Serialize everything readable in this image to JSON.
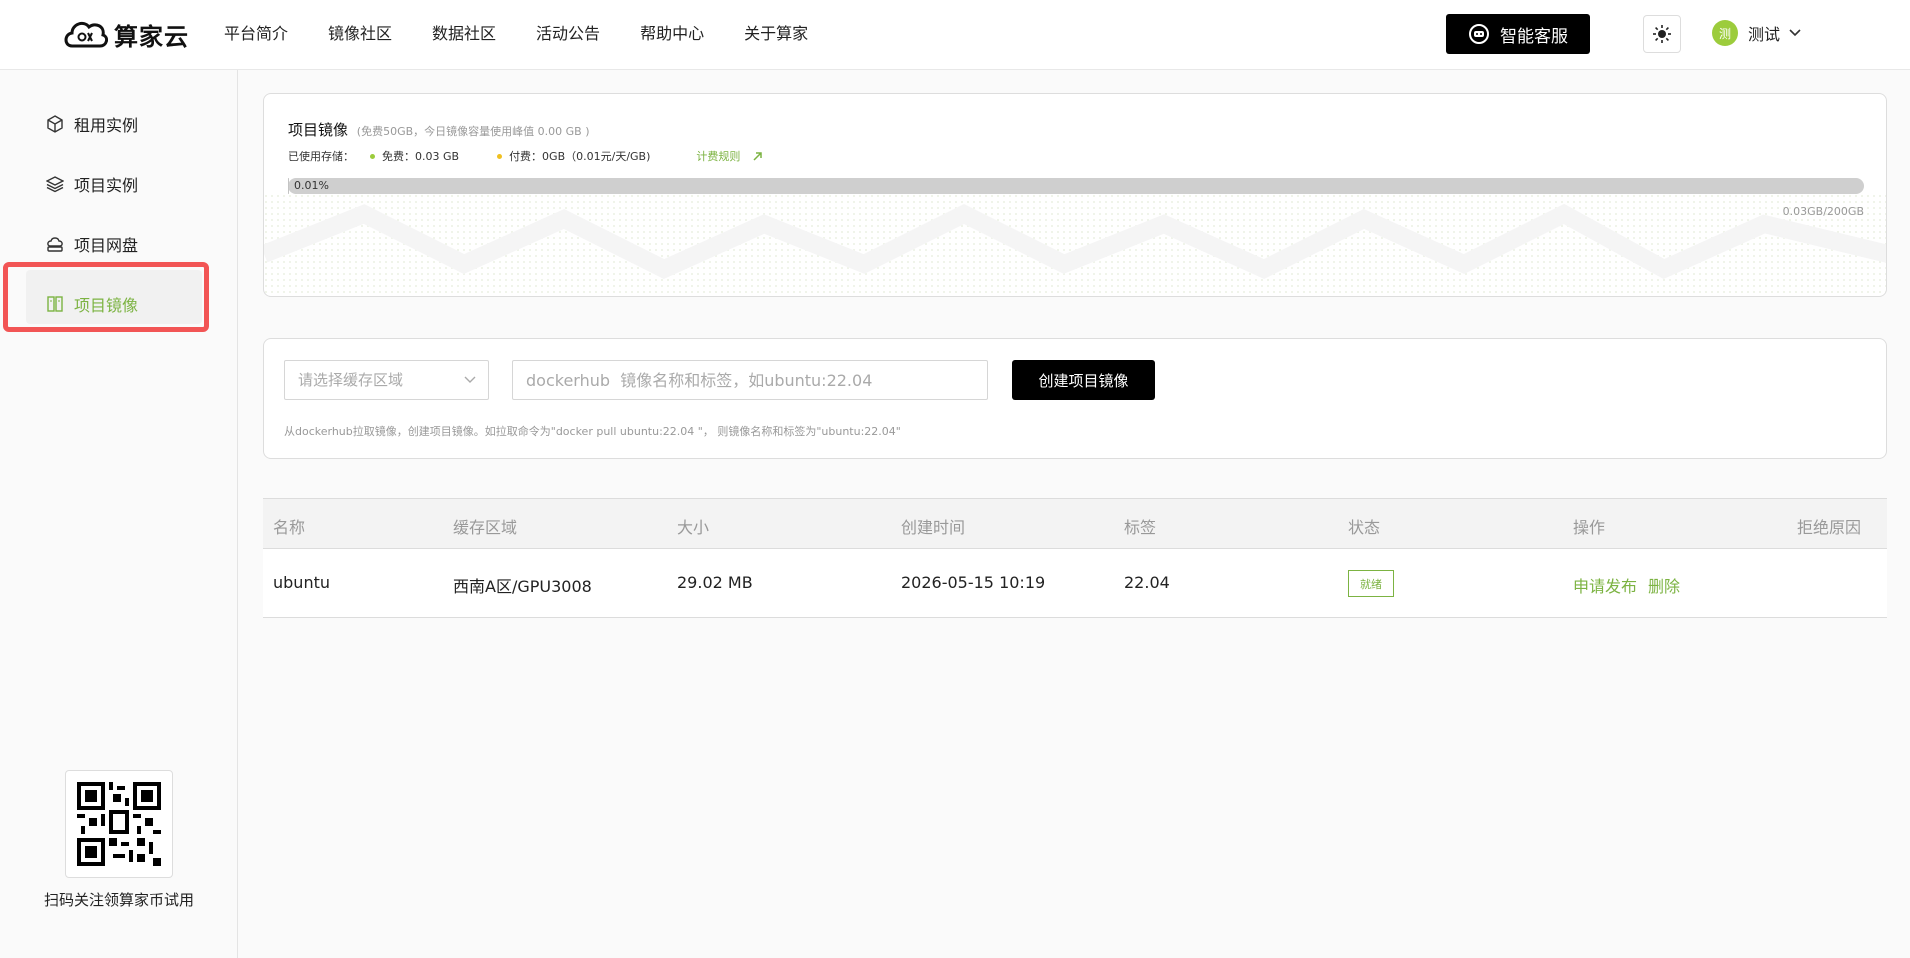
{
  "brand": {
    "name": "算家云",
    "accent": "#7cb342"
  },
  "nav": {
    "items": [
      "平台简介",
      "镜像社区",
      "数据社区",
      "活动公告",
      "帮助中心",
      "关于算家"
    ]
  },
  "header": {
    "service_label": "智能客服",
    "theme_icon": "sun-icon",
    "user_initial": "测",
    "user_name": "测试"
  },
  "sidebar": {
    "items": [
      {
        "label": "租用实例",
        "icon": "cube-icon"
      },
      {
        "label": "项目实例",
        "icon": "layers-icon"
      },
      {
        "label": "项目网盘",
        "icon": "cloud-disk-icon"
      },
      {
        "label": "项目镜像",
        "icon": "image-icon",
        "active": true
      }
    ],
    "qr_caption": "扫码关注领算家币试用"
  },
  "usage": {
    "title": "项目镜像",
    "subtitle": "(免费50GB，今日镜像容量使用峰值 0.00 GB )",
    "used_label": "已使用存储：",
    "free_label": "免费：0.03 GB",
    "paid_label": "付费：0GB（0.01元/天/GB)",
    "fee_rule": "计费规则",
    "percent_label": "0.01%",
    "percent": 0.01,
    "total_label": "0.03GB/200GB",
    "free_color": "#9ccc3c",
    "paid_color": "#f0c020"
  },
  "create": {
    "region_placeholder": "请选择缓存区域",
    "name_placeholder": "dockerhub  镜像名称和标签，如ubuntu:22.04",
    "button_label": "创建项目镜像",
    "hint": "从dockerhub拉取镜像，创建项目镜像。如拉取命令为\"docker pull ubuntu:22.04 \"， 则镜像名称和标签为\"ubuntu:22.04\""
  },
  "table": {
    "columns": [
      "名称",
      "缓存区域",
      "大小",
      "创建时间",
      "标签",
      "状态",
      "操作",
      "拒绝原因"
    ],
    "rows": [
      {
        "name": "ubuntu",
        "region": "西南A区/GPU3008",
        "size": "29.02 MB",
        "created": "2026-05-15 10:19",
        "tag": "22.04",
        "status": "就绪",
        "actions": [
          "申请发布",
          "删除"
        ],
        "reason": ""
      }
    ]
  }
}
